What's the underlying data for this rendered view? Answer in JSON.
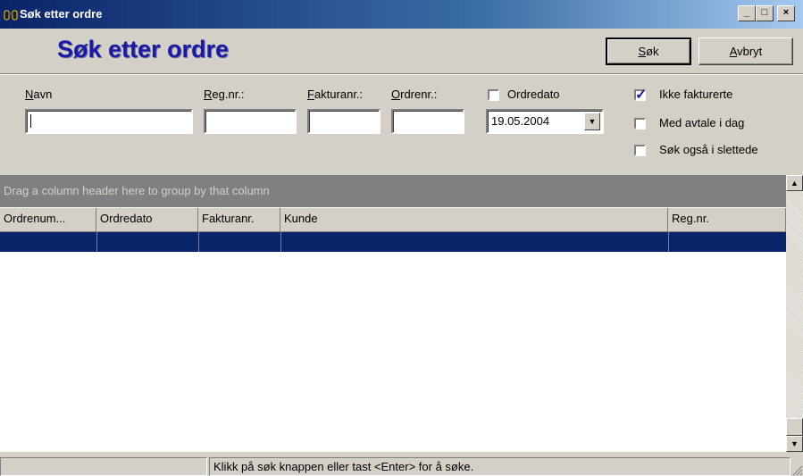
{
  "window": {
    "title": "Søk etter ordre",
    "controls": {
      "minimize": "_",
      "maximize": "□",
      "close": "×"
    }
  },
  "header": {
    "title": "Søk etter ordre",
    "search_button": {
      "label": "Søk",
      "accel": "S",
      "rest": "øk"
    },
    "cancel_button": {
      "label": "Avbryt",
      "accel": "A",
      "rest": "vbryt"
    }
  },
  "filters": {
    "name": {
      "label": "Navn",
      "accel": "N",
      "rest": "avn",
      "value": ""
    },
    "reg_nr": {
      "label": "Reg.nr.:",
      "accel": "R",
      "rest": "eg.nr.:",
      "value": ""
    },
    "invoice_nr": {
      "label": "Fakturanr.:",
      "accel": "F",
      "rest": "akturanr.:",
      "value": ""
    },
    "order_nr": {
      "label": "Ordrenr.:",
      "accel": "O",
      "rest": "rdrenr.:",
      "value": ""
    },
    "order_date": {
      "label": "Ordredato",
      "checked": false,
      "value": "19.05.2004"
    },
    "options": [
      {
        "label": "Ikke fakturerte",
        "checked": true
      },
      {
        "label": "Med avtale i dag",
        "checked": false
      },
      {
        "label": "Søk også i slettede",
        "checked": false
      }
    ]
  },
  "grid": {
    "group_hint": "Drag a column header here to group by that column",
    "columns": [
      "Ordrenum...",
      "Ordredato",
      "Fakturanr.",
      "Kunde",
      "Reg.nr."
    ],
    "rows": []
  },
  "statusbar": {
    "left": "",
    "message": "Klikk på søk knappen eller tast <Enter> for å søke."
  },
  "colors": {
    "title_bar": "#0a246a",
    "selection": "#0a246a",
    "heading": "#1a1aa6"
  }
}
